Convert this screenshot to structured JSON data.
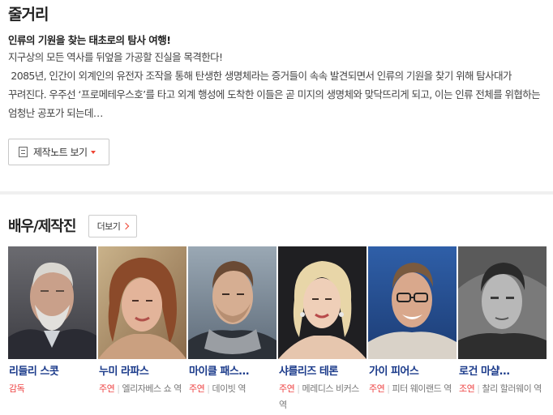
{
  "plot": {
    "title": "줄거리",
    "headline": "인류의 기원을 찾는 태초로의 탐사 여행!",
    "body": "지구상의 모든 역사를 뒤엎을 가공할 진실을 목격한다!\n 2085년, 인간이 외계인의 유전자 조작을 통해 탄생한 생명체라는 증거들이 속속 발견되면서 인류의 기원을 찾기 위해 탐사대가 꾸려진다. 우주선 ‘프로메테우스호’를 타고 외계 행성에 도착한 이들은 곧 미지의 생명체와 맞닥뜨리게 되고, 이는 인류 전체를 위협하는 엄청난 공포가 되는데…",
    "note_button": "제작노트 보기"
  },
  "cast": {
    "title": "배우/제작진",
    "more_button": "더보기",
    "members": [
      {
        "name": "리들리 스콧",
        "type": "감독",
        "role": ""
      },
      {
        "name": "누미 라파스",
        "type": "주연",
        "role": "엘리자베스 쇼 역"
      },
      {
        "name": "마이클 패스…",
        "type": "주연",
        "role": "데이빗 역"
      },
      {
        "name": "샤를리즈 테론",
        "type": "주연",
        "role": "메레디스 비커스 역"
      },
      {
        "name": "가이 피어스",
        "type": "주연",
        "role": "피터 웨이랜드 역"
      },
      {
        "name": "로건 마샬…",
        "type": "조연",
        "role": "찰리 할러웨이 역"
      }
    ]
  },
  "colors": {
    "accent": "#e44444",
    "name_link": "#1a3a8a"
  },
  "icons": [
    "document-icon",
    "caret-down-icon",
    "chevron-right-icon"
  ]
}
